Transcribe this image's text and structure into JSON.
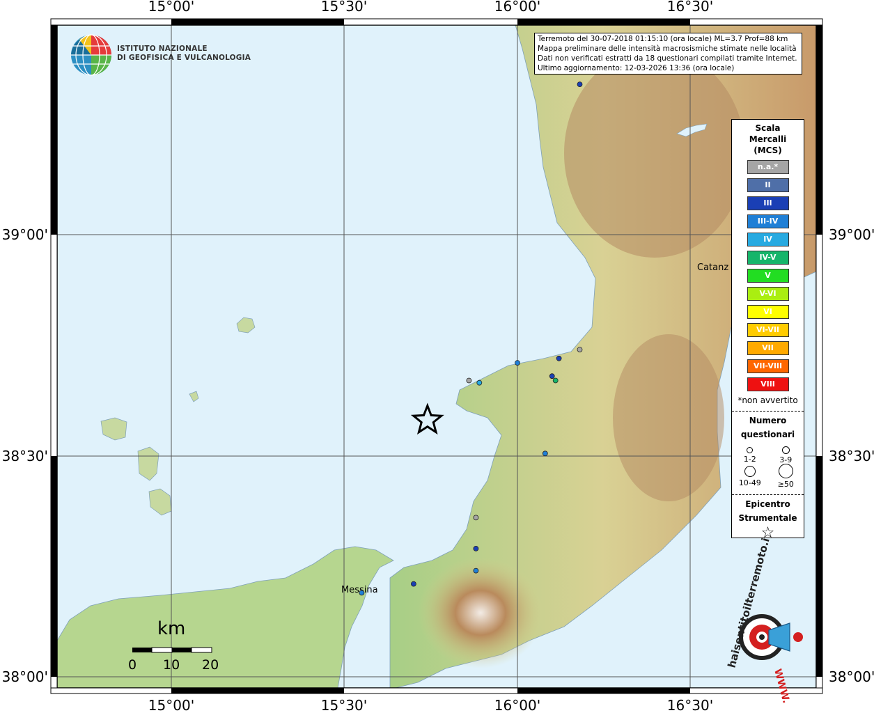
{
  "map": {
    "lon_ticks": [
      "15°00'",
      "15°30'",
      "16°00'",
      "16°30'"
    ],
    "lat_ticks": [
      "39°00'",
      "38°30'",
      "38°00'"
    ],
    "places": [
      {
        "name": "Messina"
      },
      {
        "name": "Catanz"
      }
    ],
    "colors": {
      "sea": "#e0f2fb",
      "land_low": "#9ecb7f",
      "land_mid": "#d8cf8f",
      "land_high": "#b9845a"
    }
  },
  "info": {
    "line1": "Terremoto del 30-07-2018 01:15:10 (ora locale) ML=3.7 Prof=88 km",
    "line2": "Mappa preliminare delle intensità macrosismiche stimate nelle località",
    "line3": "Dati non verificati estratti da 18 questionari compilati tramite Internet.",
    "line4": "Ultimo aggiornamento: 12-03-2026 13:36 (ora locale)"
  },
  "logo": {
    "line1": "ISTITUTO NAZIONALE",
    "line2": "DI GEOFISICA E VULCANOLOGIA"
  },
  "legend": {
    "title": [
      "Scala",
      "Mercalli",
      "(MCS)"
    ],
    "items": [
      {
        "label": "n.a.*",
        "color": "#a5a5a5"
      },
      {
        "label": "II",
        "color": "#4f6fa8"
      },
      {
        "label": "III",
        "color": "#1a3fb5"
      },
      {
        "label": "III-IV",
        "color": "#1f7fd6"
      },
      {
        "label": "IV",
        "color": "#27aae1"
      },
      {
        "label": "IV-V",
        "color": "#16b56a"
      },
      {
        "label": "V",
        "color": "#22dd22"
      },
      {
        "label": "V-VI",
        "color": "#aaee11"
      },
      {
        "label": "VI",
        "color": "#ffff00"
      },
      {
        "label": "VI-VII",
        "color": "#ffcc00"
      },
      {
        "label": "VII",
        "color": "#ffaa00"
      },
      {
        "label": "VII-VIII",
        "color": "#ff6600"
      },
      {
        "label": "VIII",
        "color": "#ee1111"
      }
    ],
    "note": "*non avvertito",
    "count_title": [
      "Numero",
      "questionari"
    ],
    "sizes": [
      "1-2",
      "3-9",
      "10-49",
      "≥50"
    ],
    "epicenter_title": [
      "Epicentro",
      "Strumentale"
    ],
    "star_symbol": "☆"
  },
  "scalebar": {
    "unit": "km",
    "labels": [
      "0",
      "10",
      "20"
    ]
  },
  "points": [
    {
      "lon": 16.18,
      "lat": 39.34,
      "intensity": "III"
    },
    {
      "lon": 16.18,
      "lat": 38.74,
      "intensity": "n.a.*"
    },
    {
      "lon": 16.12,
      "lat": 38.72,
      "intensity": "III"
    },
    {
      "lon": 16.0,
      "lat": 38.71,
      "intensity": "III-IV"
    },
    {
      "lon": 16.1,
      "lat": 38.68,
      "intensity": "III"
    },
    {
      "lon": 16.11,
      "lat": 38.67,
      "intensity": "IV-V"
    },
    {
      "lon": 15.86,
      "lat": 38.67,
      "intensity": "n.a.*"
    },
    {
      "lon": 15.89,
      "lat": 38.665,
      "intensity": "IV"
    },
    {
      "lon": 16.08,
      "lat": 38.505,
      "intensity": "III-IV"
    },
    {
      "lon": 15.88,
      "lat": 38.36,
      "intensity": "n.a.*"
    },
    {
      "lon": 15.88,
      "lat": 38.29,
      "intensity": "III"
    },
    {
      "lon": 15.88,
      "lat": 38.24,
      "intensity": "III-IV"
    },
    {
      "lon": 15.7,
      "lat": 38.21,
      "intensity": "III"
    },
    {
      "lon": 15.55,
      "lat": 38.19,
      "intensity": "III-IV"
    }
  ],
  "epicenter": {
    "lon": 15.74,
    "lat": 38.58
  },
  "watermark": {
    "text": "haisentitoilterremoto.it",
    "url": "WWW."
  }
}
